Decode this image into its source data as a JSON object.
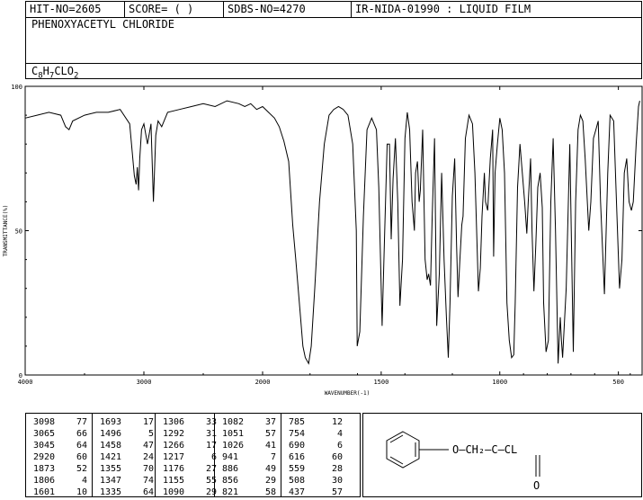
{
  "header": {
    "hit_no": "HIT-NO=2605",
    "score": "SCORE=  (   )",
    "sdbs_no": "SDBS-NO=4270",
    "ir_info": "IR-NIDA-01990 : LIQUID FILM",
    "compound_name": "PHENOXYACETYL CHLORIDE",
    "formula": {
      "C": "C",
      "c": "8",
      "H": "H",
      "h": "7",
      "rest": "CLO",
      "o": "2"
    }
  },
  "chart_data": {
    "type": "line",
    "xlabel": "WAVENUMBER(-1)",
    "ylabel": "TRANSMITTANCE(%)",
    "xlim": [
      4000,
      400
    ],
    "ylim": [
      0,
      100
    ],
    "x_ticks": [
      4000,
      3000,
      2000,
      1500,
      1000,
      500
    ],
    "y_ticks": [
      0,
      50,
      100
    ],
    "series": [
      {
        "x": [
          4000,
          3900,
          3800,
          3700,
          3660,
          3630,
          3600,
          3500,
          3400,
          3300,
          3200,
          3120,
          3098,
          3080,
          3065,
          3055,
          3045,
          3035,
          3020,
          3000,
          2970,
          2940,
          2920,
          2900,
          2880,
          2850,
          2800,
          2700,
          2600,
          2500,
          2400,
          2300,
          2200,
          2150,
          2100,
          2050,
          2000,
          1950,
          1930,
          1910,
          1890,
          1873,
          1860,
          1840,
          1830,
          1820,
          1806,
          1795,
          1780,
          1760,
          1740,
          1720,
          1700,
          1680,
          1660,
          1640,
          1620,
          1605,
          1601,
          1590,
          1575,
          1560,
          1540,
          1520,
          1510,
          1496,
          1485,
          1475,
          1465,
          1458,
          1450,
          1440,
          1430,
          1421,
          1410,
          1400,
          1390,
          1380,
          1370,
          1360,
          1355,
          1347,
          1340,
          1335,
          1325,
          1315,
          1306,
          1300,
          1292,
          1285,
          1275,
          1266,
          1255,
          1245,
          1235,
          1225,
          1217,
          1210,
          1200,
          1190,
          1182,
          1176,
          1168,
          1160,
          1155,
          1145,
          1130,
          1115,
          1105,
          1090,
          1082,
          1075,
          1065,
          1060,
          1051,
          1040,
          1030,
          1026,
          1020,
          1010,
          1000,
          990,
          980,
          970,
          960,
          950,
          941,
          935,
          925,
          915,
          905,
          895,
          886,
          880,
          870,
          864,
          856,
          848,
          840,
          830,
          821,
          815,
          805,
          795,
          785,
          775,
          765,
          754,
          745,
          740,
          735,
          720,
          705,
          690,
          680,
          670,
          660,
          650,
          640,
          625,
          616,
          605,
          595,
          585,
          575,
          559,
          545,
          535,
          520,
          508,
          495,
          485,
          475,
          465,
          455,
          445,
          437,
          425,
          415,
          410
        ],
        "y": [
          89,
          90,
          91,
          90,
          86,
          85,
          88,
          90,
          91,
          91,
          92,
          87,
          77,
          69,
          66,
          72,
          64,
          75,
          85,
          87,
          80,
          87,
          60,
          83,
          88,
          86,
          91,
          92,
          93,
          94,
          93,
          95,
          94,
          93,
          94,
          92,
          93,
          89,
          86,
          81,
          74,
          52,
          40,
          20,
          10,
          6,
          4,
          10,
          30,
          60,
          80,
          90,
          92,
          93,
          92,
          90,
          80,
          50,
          10,
          15,
          55,
          85,
          89,
          85,
          65,
          17,
          50,
          80,
          80,
          47,
          68,
          82,
          60,
          24,
          40,
          82,
          91,
          85,
          60,
          50,
          70,
          74,
          60,
          64,
          85,
          40,
          33,
          35,
          31,
          55,
          82,
          17,
          35,
          70,
          40,
          20,
          6,
          25,
          62,
          75,
          45,
          27,
          40,
          52,
          55,
          82,
          90,
          87,
          70,
          29,
          37,
          55,
          70,
          60,
          57,
          75,
          85,
          41,
          70,
          80,
          89,
          85,
          70,
          25,
          12,
          6,
          7,
          25,
          65,
          80,
          70,
          60,
          49,
          60,
          75,
          50,
          29,
          45,
          65,
          70,
          58,
          25,
          8,
          12,
          60,
          82,
          50,
          4,
          20,
          12,
          6,
          30,
          80,
          8,
          60,
          85,
          90,
          88,
          75,
          50,
          60,
          82,
          85,
          88,
          60,
          28,
          70,
          90,
          88,
          60,
          30,
          40,
          70,
          75,
          60,
          57,
          60,
          80,
          93,
          95
        ]
      }
    ]
  },
  "peak_table": [
    [
      [
        "3098",
        "77"
      ],
      [
        "3065",
        "66"
      ],
      [
        "3045",
        "64"
      ],
      [
        "2920",
        "60"
      ],
      [
        "1873",
        "52"
      ],
      [
        "1806",
        "4"
      ],
      [
        "1601",
        "10"
      ]
    ],
    [
      [
        "1693",
        "17"
      ],
      [
        "1496",
        "5"
      ],
      [
        "1458",
        "47"
      ],
      [
        "1421",
        "24"
      ],
      [
        "1355",
        "70"
      ],
      [
        "1347",
        "74"
      ],
      [
        "1335",
        "64"
      ]
    ],
    [
      [
        "1306",
        "33"
      ],
      [
        "1292",
        "31"
      ],
      [
        "1266",
        "17"
      ],
      [
        "1217",
        "6"
      ],
      [
        "1176",
        "27"
      ],
      [
        "1155",
        "55"
      ],
      [
        "1090",
        "29"
      ]
    ],
    [
      [
        "1082",
        "37"
      ],
      [
        "1051",
        "57"
      ],
      [
        "1026",
        "41"
      ],
      [
        "941",
        "7"
      ],
      [
        "886",
        "49"
      ],
      [
        "856",
        "29"
      ],
      [
        "821",
        "58"
      ]
    ],
    [
      [
        "785",
        "12"
      ],
      [
        "754",
        "4"
      ],
      [
        "690",
        "6"
      ],
      [
        "616",
        "60"
      ],
      [
        "559",
        "28"
      ],
      [
        "508",
        "30"
      ],
      [
        "437",
        "57"
      ]
    ]
  ],
  "structure": {
    "chain_label": "O—CH₂—C—CL",
    "carbonyl_o": "O"
  }
}
